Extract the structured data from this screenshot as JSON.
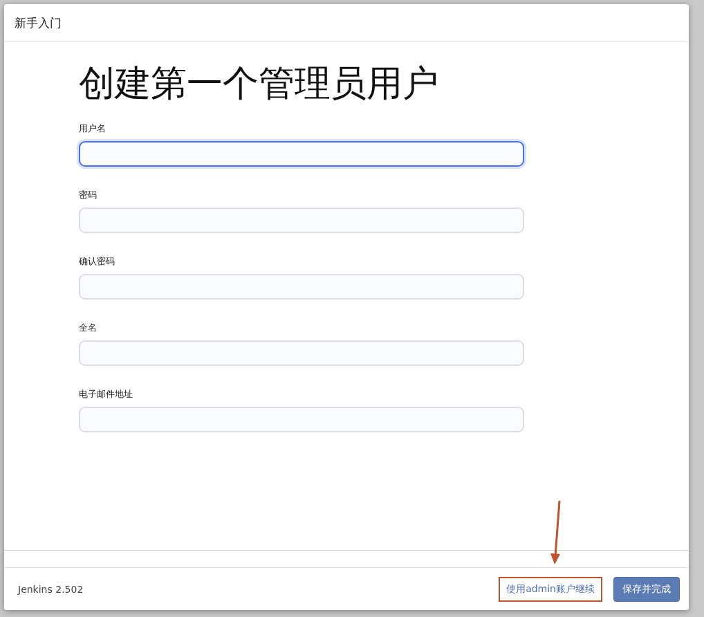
{
  "dialog": {
    "title": "新手入门"
  },
  "heading": "创建第一个管理员用户",
  "fields": [
    {
      "label": "用户名",
      "focused": true
    },
    {
      "label": "密码",
      "focused": false
    },
    {
      "label": "确认密码",
      "focused": false
    },
    {
      "label": "全名",
      "focused": false
    },
    {
      "label": "电子邮件地址",
      "focused": false
    }
  ],
  "footer": {
    "version": "Jenkins 2.502",
    "link": {
      "label": "使用admin账户继续",
      "highlighted": true
    },
    "button": {
      "label": "保存并完成"
    }
  }
}
